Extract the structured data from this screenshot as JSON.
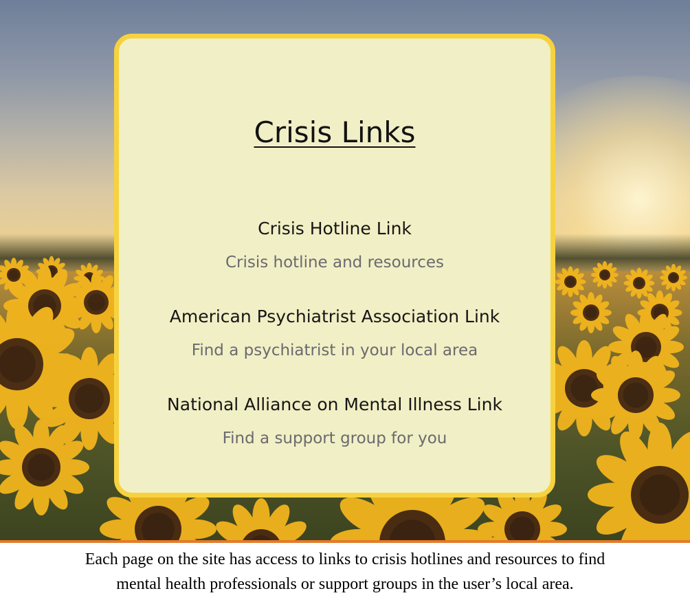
{
  "card": {
    "title": "Crisis Links",
    "links": [
      {
        "title": "Crisis Hotline Link",
        "description": "Crisis hotline and resources"
      },
      {
        "title": "American Psychiatrist Association Link",
        "description": "Find a psychiatrist in your local area"
      },
      {
        "title": "National Alliance on Mental Illness Link",
        "description": "Find a support group for you"
      }
    ]
  },
  "caption": {
    "line1": "Each page on the site has access to links to crisis hotlines and resources to find",
    "line2": "mental health professionals  or support groups in the user’s local area."
  },
  "colors": {
    "card_background": "#f1efc5",
    "card_border": "#f7d23f",
    "divider": "#e57a2a"
  }
}
